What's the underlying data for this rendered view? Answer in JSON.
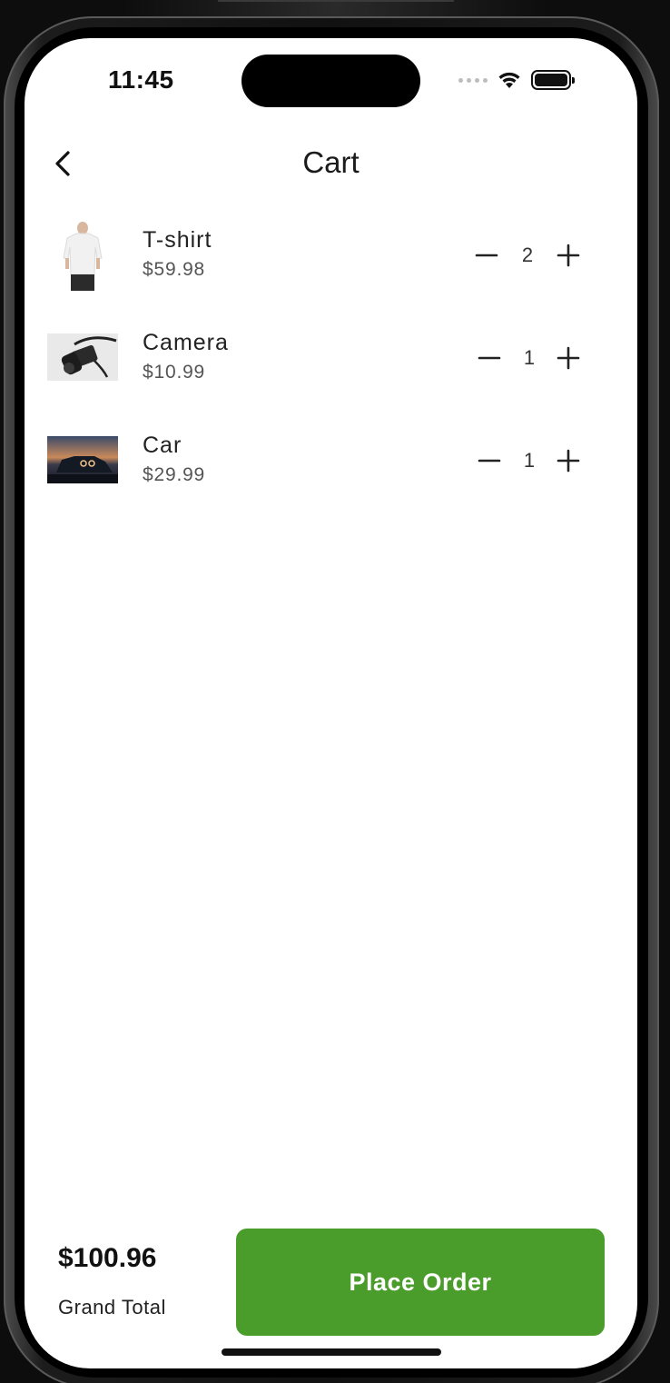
{
  "status_bar": {
    "time": "11:45"
  },
  "nav": {
    "title": "Cart",
    "back_icon": "chevron-left-icon"
  },
  "cart": {
    "items": [
      {
        "name": "T-shirt",
        "price": "$59.98",
        "quantity": "2",
        "image": "tshirt-photo"
      },
      {
        "name": "Camera",
        "price": "$10.99",
        "quantity": "1",
        "image": "camera-photo"
      },
      {
        "name": "Car",
        "price": "$29.99",
        "quantity": "1",
        "image": "car-photo"
      }
    ]
  },
  "footer": {
    "grand_total": "$100.96",
    "grand_total_label": "Grand Total",
    "place_order_label": "Place Order"
  },
  "colors": {
    "accent": "#4a9c2b",
    "background": "#ffffff",
    "frame": "#111111"
  }
}
